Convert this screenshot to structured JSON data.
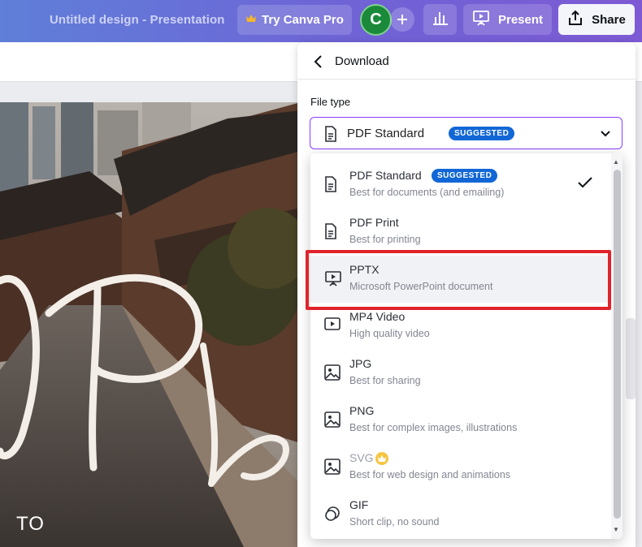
{
  "topbar": {
    "title": "Untitled design - Presentation",
    "pro_label": "Try Canva Pro",
    "avatar_initial": "C",
    "present_label": "Present",
    "share_label": "Share"
  },
  "canvas": {
    "text": "TO"
  },
  "panel": {
    "title": "Download",
    "file_type_label": "File type",
    "selected_value": "PDF Standard",
    "selected_badge": "SUGGESTED"
  },
  "dropdown": {
    "options": [
      {
        "name": "PDF Standard",
        "desc": "Best for documents (and emailing)",
        "badge": "SUGGESTED",
        "icon": "document-icon"
      },
      {
        "name": "PDF Print",
        "desc": "Best for printing",
        "icon": "document-icon"
      },
      {
        "name": "PPTX",
        "desc": "Microsoft PowerPoint document",
        "icon": "presentation-icon"
      },
      {
        "name": "MP4 Video",
        "desc": "High quality video",
        "icon": "video-icon"
      },
      {
        "name": "JPG",
        "desc": "Best for sharing",
        "icon": "image-icon"
      },
      {
        "name": "PNG",
        "desc": "Best for complex images, illustrations",
        "icon": "image-icon"
      },
      {
        "name": "SVG",
        "desc": "Best for web design and animations",
        "icon": "image-icon"
      },
      {
        "name": "GIF",
        "desc": "Short clip, no sound",
        "icon": "gif-icon"
      }
    ]
  },
  "colors": {
    "accent": "#8b3dff",
    "badge": "#1267d6",
    "highlight_border": "#e0232b"
  }
}
